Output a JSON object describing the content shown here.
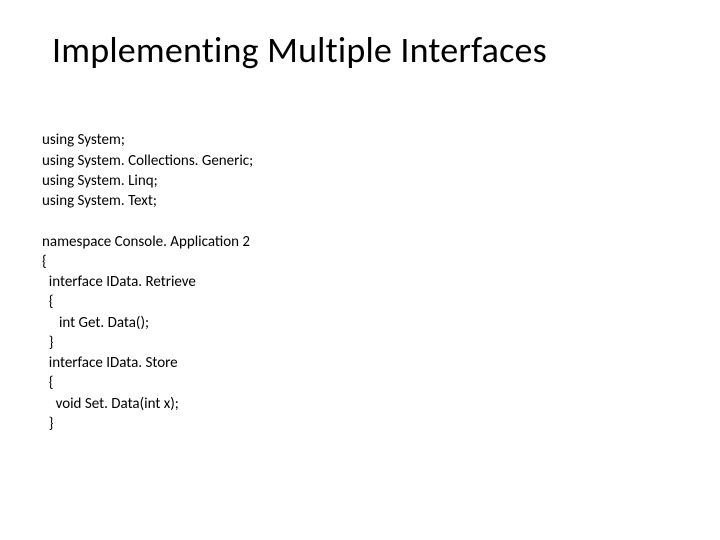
{
  "title": "Implementing Multiple Interfaces",
  "code": {
    "l01": "using System;",
    "l02": "using System. Collections. Generic;",
    "l03": "using System. Linq;",
    "l04": "using System. Text;",
    "l05": "",
    "l06": "namespace Console. Application 2",
    "l07": "{",
    "l08": "  interface IData. Retrieve",
    "l09": "  {",
    "l10": "     int Get. Data();",
    "l11": "  }",
    "l12": "  interface IData. Store",
    "l13": "  {",
    "l14": "    void Set. Data(int x);",
    "l15": "  }"
  }
}
